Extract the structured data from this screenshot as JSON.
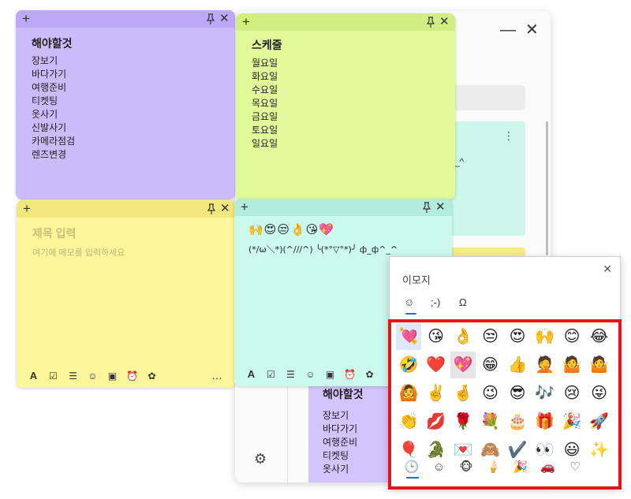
{
  "background_window": {
    "minimize_icon": "minimize-icon",
    "close_icon": "close-icon",
    "card_fragment": "-_^",
    "list_title": "해야할것",
    "list_items": [
      "장보기",
      "바다가기",
      "여행준비",
      "티켓팅",
      "옷사기"
    ],
    "settings_icon": "gear-icon"
  },
  "notes": {
    "purple": {
      "color": "#cbbbfb",
      "title": "해야할것",
      "items": [
        "장보기",
        "바다가기",
        "여행준비",
        "티켓팅",
        "옷사기",
        "신발사기",
        "카메라점검",
        "렌즈변경"
      ]
    },
    "green": {
      "color": "#e0fa9a",
      "title": "스케줄",
      "items": [
        "월요일",
        "화요일",
        "수요일",
        "목요일",
        "금요일",
        "토요일",
        "일요일"
      ]
    },
    "yellow": {
      "color": "#fdf69b",
      "title_placeholder": "제목 입력",
      "body_placeholder": "여기에 메모를 입력하세요",
      "more_label": "…"
    },
    "mint": {
      "color": "#cbf9ec",
      "emoji_line": "🙌😍😒👌😘💖",
      "kaomoji_line": "(*/ω＼*)(^///^) ╰(*°▽°*)╯ ф_ф^_^"
    }
  },
  "note_chrome": {
    "add_label": "+",
    "close_label": "✕"
  },
  "toolbar": {
    "font_label": "A",
    "icons": [
      "checkbox-icon",
      "list-icon",
      "emoji-icon",
      "image-icon",
      "alarm-icon",
      "palette-icon"
    ]
  },
  "emoji_picker": {
    "title": "이모지",
    "close_label": "✕",
    "tabs": [
      {
        "label": "☺",
        "name": "emoji"
      },
      {
        "label": ";-)",
        "name": "kaomoji"
      },
      {
        "label": "Ω",
        "name": "symbols"
      }
    ],
    "active_tab": "emoji",
    "emoji_grid": [
      [
        "💘",
        "😘",
        "👌",
        "😒",
        "😍",
        "🙌",
        "😊",
        "😂"
      ],
      [
        "🤣",
        "❤️",
        "💖",
        "😁",
        "👍",
        "🤦",
        "🤷",
        "🤷"
      ],
      [
        "🙆",
        "✌️",
        "🤞",
        "😉",
        "😎",
        "🎶",
        "😢",
        "😜"
      ],
      [
        "👏",
        "💋",
        "🌹",
        "💐",
        "🎂",
        "🎁",
        "🎉",
        "🚀"
      ],
      [
        "🎈",
        "🐊",
        "💌",
        "🙈",
        "✔️",
        "👀",
        "😃",
        "✨"
      ]
    ],
    "selected_cell": "💘",
    "hovered_cell": "💖",
    "categories": [
      "🕒",
      "☺",
      "🐵",
      "🍦",
      "🎉",
      "🚗",
      "♡"
    ],
    "active_category": "🕒"
  },
  "colors": {
    "highlight_border": "#e8141b",
    "accent": "#1f6fd6"
  }
}
